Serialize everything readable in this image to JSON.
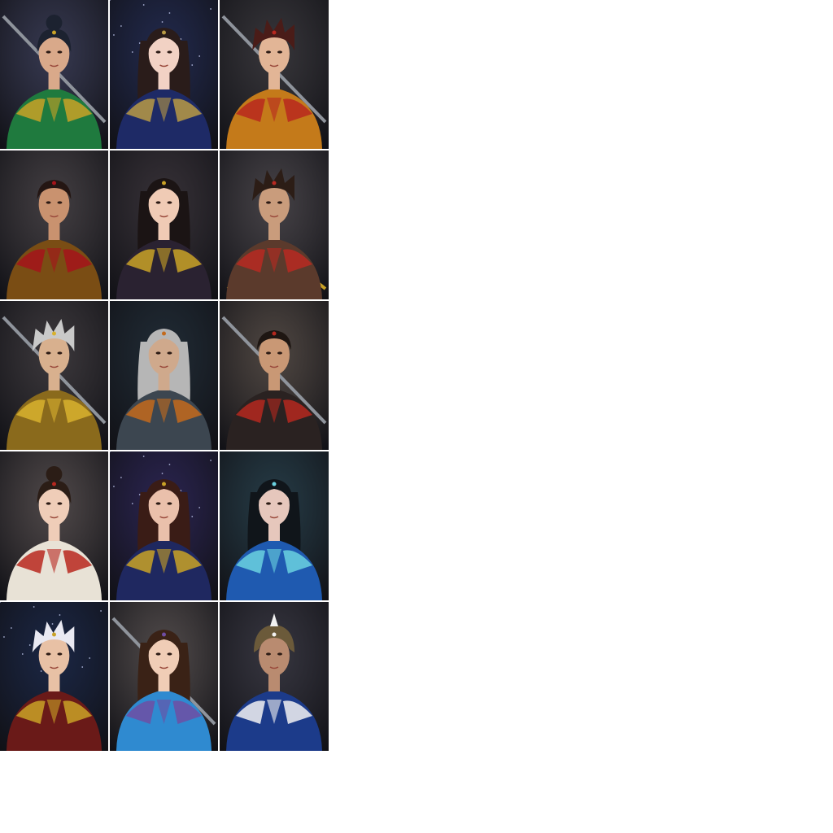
{
  "gallery": {
    "columns": 3,
    "tiles": [
      {
        "icon": "warrior-portrait",
        "bg": "#3a3e5a",
        "hair": "#1c2230",
        "skin": "#d9a98a",
        "armor": "#1f7a3e",
        "accent": "#c9a227",
        "hair_style": "bun",
        "weapon": "sword"
      },
      {
        "icon": "lady-portrait",
        "bg": "#1f2a55",
        "hair": "#2a1c1a",
        "skin": "#f2d2c4",
        "armor": "#1e2a66",
        "accent": "#b89a45",
        "hair_style": "long",
        "weapon": "none"
      },
      {
        "icon": "swordsman-portrait",
        "bg": "#3b3a3d",
        "hair": "#4a1c18",
        "skin": "#e2b596",
        "armor": "#c47a1a",
        "accent": "#b8281f",
        "hair_style": "wild",
        "weapon": "sword"
      },
      {
        "icon": "general-portrait",
        "bg": "#4a4547",
        "hair": "#241613",
        "skin": "#c9926f",
        "armor": "#7a4d14",
        "accent": "#a5141a",
        "hair_style": "short",
        "weapon": "none"
      },
      {
        "icon": "priestess-portrait",
        "bg": "#3a3439",
        "hair": "#1b1414",
        "skin": "#f0cbb5",
        "armor": "#2a2231",
        "accent": "#c9a227",
        "hair_style": "long",
        "weapon": "none"
      },
      {
        "icon": "archer-portrait",
        "bg": "#4e4a4d",
        "hair": "#2c1d16",
        "skin": "#c99c7c",
        "armor": "#5b3a2c",
        "accent": "#b92a22",
        "hair_style": "wild",
        "weapon": "bow"
      },
      {
        "icon": "silver-hair-warrior-portrait",
        "bg": "#413d3f",
        "hair": "#c9c9c9",
        "skin": "#d8b08e",
        "armor": "#8a6a1c",
        "accent": "#d8b12e",
        "hair_style": "wild",
        "weapon": "sword"
      },
      {
        "icon": "dark-knight-portrait",
        "bg": "#1d2c36",
        "hair": "#b6b6b6",
        "skin": "#cfa98c",
        "armor": "#3c4650",
        "accent": "#c36a1c",
        "hair_style": "long",
        "weapon": "none"
      },
      {
        "icon": "armored-lord-portrait",
        "bg": "#5a5047",
        "hair": "#1e1612",
        "skin": "#c99875",
        "armor": "#2a2221",
        "accent": "#b5281e",
        "hair_style": "short",
        "weapon": "sword"
      },
      {
        "icon": "court-lady-portrait",
        "bg": "#5a5250",
        "hair": "#2b1d16",
        "skin": "#efcdb8",
        "armor": "#e8e2d6",
        "accent": "#b8281f",
        "hair_style": "bun",
        "weapon": "none"
      },
      {
        "icon": "sorceress-portrait",
        "bg": "#2a2359",
        "hair": "#3a1c16",
        "skin": "#eac0ab",
        "armor": "#1f2860",
        "accent": "#c9a227",
        "hair_style": "long",
        "weapon": "none"
      },
      {
        "icon": "jade-maiden-portrait",
        "bg": "#24414c",
        "hair": "#10151a",
        "skin": "#e6c7bc",
        "armor": "#1f5ab0",
        "accent": "#6bd2e0",
        "hair_style": "long",
        "weapon": "none"
      },
      {
        "icon": "white-hair-youth-portrait",
        "bg": "#16264a",
        "hair": "#e9e9f2",
        "skin": "#e8c1a5",
        "armor": "#6a1a18",
        "accent": "#c9a227",
        "hair_style": "wild",
        "weapon": "none"
      },
      {
        "icon": "blue-dress-lady-portrait",
        "bg": "#5c5552",
        "hair": "#3a2216",
        "skin": "#f0cdb6",
        "armor": "#2f8ad0",
        "accent": "#6f4da3",
        "hair_style": "long",
        "weapon": "sword"
      },
      {
        "icon": "fur-cloak-warlord-portrait",
        "bg": "#3a3a44",
        "hair": "#1a1618",
        "skin": "#b98b70",
        "armor": "#1c3b8a",
        "accent": "#f2f2f2",
        "hair_style": "helmet",
        "weapon": "none"
      }
    ]
  }
}
